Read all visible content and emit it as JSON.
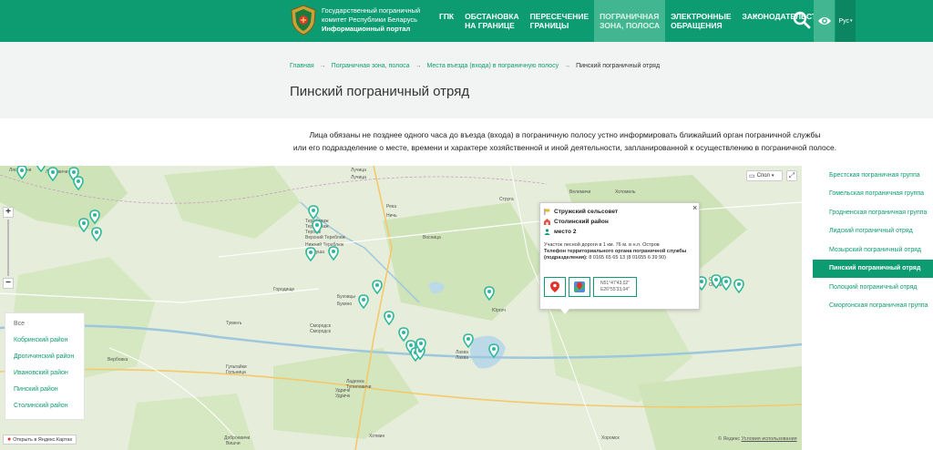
{
  "header": {
    "brand_line1": "Государственный пограничный",
    "brand_line2": "комитет Республики Беларусь",
    "brand_sub": "Информационный портал",
    "nav": [
      {
        "label": "ГПК",
        "active": false
      },
      {
        "label": "ОБСТАНОВКА\nНА ГРАНИЦЕ",
        "active": false
      },
      {
        "label": "ПЕРЕСЕЧЕНИЕ\nГРАНИЦЫ",
        "active": false
      },
      {
        "label": "ПОГРАНИЧНАЯ\nЗОНА, ПОЛОСА",
        "active": true
      },
      {
        "label": "ЭЛЕКТРОННЫЕ\nОБРАЩЕНИЯ",
        "active": false
      },
      {
        "label": "ЗАКОНОДАТЕЛЬСТВО",
        "active": false
      }
    ],
    "more": "...",
    "lang": "Рус",
    "icons": {
      "search": "search-icon",
      "eye": "eye-icon"
    }
  },
  "breadcrumb": {
    "items": [
      "Главная",
      "Пограничная зона, полоса",
      "Места въезда (входа) в пограничную полосу"
    ],
    "separator": "→",
    "current": "Пинский пограничный отряд"
  },
  "page_title": "Пинский пограничный отряд",
  "notice": {
    "line1": "Лица обязаны не позднее одного часа до въезда (входа) в пограничную полосу устно информировать ближайший орган пограничной службы",
    "line2": "или его подразделение о месте, времени и характере хозяйственной и иной деятельности, запланированной к осуществлению в пограничной полосе."
  },
  "map": {
    "layers_label": "Спол",
    "zoom_in": "+",
    "zoom_out": "−",
    "open_yandex": "Открыть в Яндекс.Картах",
    "copyright": "© Яндекс",
    "terms": "Условия использования",
    "districts": [
      "Все",
      "Кобринский район",
      "Дрогичинский район",
      "Ивановский район",
      "Пинский район",
      "Столинский район"
    ],
    "place_labels": [
      "Лясковичи",
      "Лясковичи",
      "Струга",
      "Велемичи",
      "Хотомель",
      "Река",
      "Ничь",
      "Лучица",
      "Лучица",
      "Тереблиаж",
      "Тереблиаж",
      "Терпеж",
      "Верхний Тереблеж",
      "Нижний Тереблеж",
      "Белоуша",
      "Восница",
      "Городище",
      "Буховцы",
      "Букино",
      "Смородск",
      "Смородск",
      "Туменъ",
      "Вербовка",
      "Гультайки",
      "Гольница",
      "Ладенка",
      "Тупиловичи",
      "Удричк",
      "Удричк",
      "Хотмин",
      "Лахва",
      "Лахва",
      "Оконь",
      "Оконь",
      "Доброевичи",
      "Вишчи",
      "Хоромск",
      "Юргоч"
    ],
    "popup": {
      "council": "Стружский сельсовет",
      "district": "Столинский район",
      "place": "место 2",
      "description": "Участок лесной дороги в 1 км. 76 м. в н.п. Остров",
      "phone_label": "Телефон территориального органа пограничной службы (подразделения):",
      "phone": "8 0165 65 65 13 (8 01655 6 39 90)",
      "coords": "N51°47'43,02\" E26°55'33,04\"",
      "close": "×"
    }
  },
  "sidebar": {
    "items": [
      {
        "label": "Брестская пограничная группа",
        "active": false
      },
      {
        "label": "Гомельская пограничная группа",
        "active": false
      },
      {
        "label": "Гродненская пограничная группа",
        "active": false
      },
      {
        "label": "Лидский пограничный отряд",
        "active": false
      },
      {
        "label": "Мозырский пограничный отряд",
        "active": false
      },
      {
        "label": "Пинский пограничный отряд",
        "active": true
      },
      {
        "label": "Полоцкий пограничный отряд",
        "active": false
      },
      {
        "label": "Сморгонская пограничная группа",
        "active": false
      }
    ]
  },
  "colors": {
    "brand": "#0d9c71",
    "accent": "#41b690",
    "marker": "#2fb89a"
  }
}
